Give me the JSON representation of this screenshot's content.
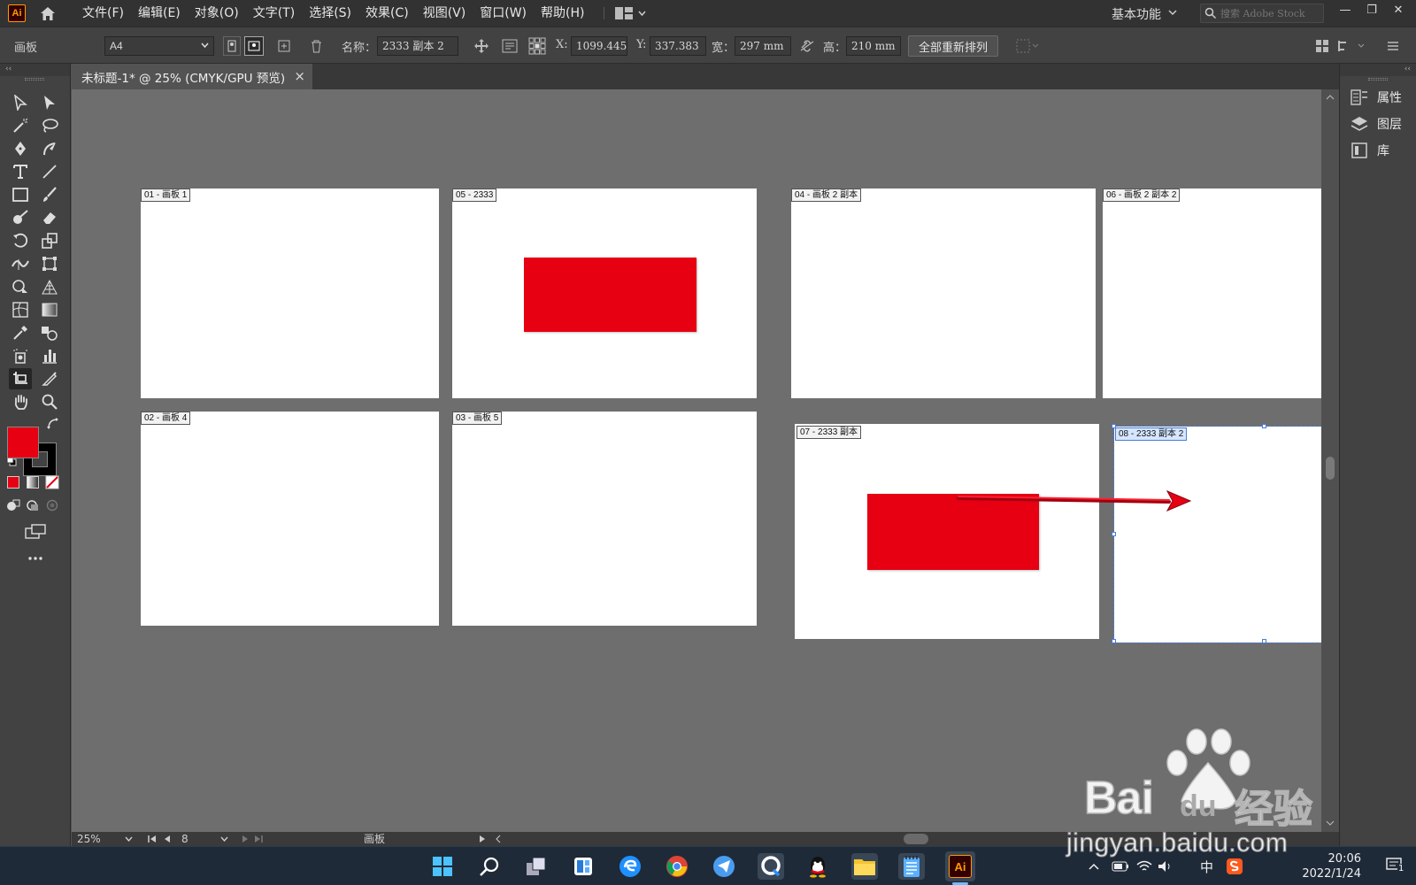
{
  "app": {
    "logo": "Ai",
    "home_icon": "home-icon"
  },
  "menu": [
    "文件(F)",
    "编辑(E)",
    "对象(O)",
    "文字(T)",
    "选择(S)",
    "效果(C)",
    "视图(V)",
    "窗口(W)",
    "帮助(H)"
  ],
  "workspace": {
    "name": "基本功能",
    "search_placeholder": "搜索 Adobe Stock"
  },
  "window_controls": {
    "minimize": "—",
    "restore": "❐",
    "close": "✕"
  },
  "control": {
    "tool_name": "画板",
    "preset": "A4",
    "name_label": "名称：",
    "name_value": "2333 副本 2",
    "x_label": "X:",
    "x_value": "1099.445",
    "y_label": "Y:",
    "y_value": "337.383",
    "w_label": "宽：",
    "w_value": "297 mm",
    "h_label": "高：",
    "h_value": "210 mm",
    "rearrange_label": "全部重新排列"
  },
  "document": {
    "tab_title": "未标题-1* @ 25% (CMYK/GPU 预览)",
    "close": "×"
  },
  "artboards": [
    {
      "label": "01 - 画板 1"
    },
    {
      "label": "05 - 2333"
    },
    {
      "label": "04 - 画板 2 副本"
    },
    {
      "label": "06 - 画板 2 副本 2"
    },
    {
      "label": "02 - 画板 4"
    },
    {
      "label": "03 - 画板 5"
    },
    {
      "label": "07 - 2333 副本"
    },
    {
      "label": "08 - 2333 副本 2"
    }
  ],
  "colors": {
    "fill": "#e60012",
    "stroke": "#000000",
    "accent": "#ff9a00"
  },
  "right_panel": [
    {
      "label": "属性",
      "icon": "properties-icon"
    },
    {
      "label": "图层",
      "icon": "layers-icon"
    },
    {
      "label": "库",
      "icon": "libraries-icon"
    }
  ],
  "status": {
    "zoom": "25%",
    "artboard_index": "8",
    "tool": "画板"
  },
  "taskbar": {
    "ime": "中",
    "time": "20:06",
    "date": "2022/1/24",
    "notifications": "1"
  },
  "watermark": {
    "line1": "Bai",
    "line2": "du",
    "line3": "经验",
    "url": "jingyan.baidu.com"
  }
}
